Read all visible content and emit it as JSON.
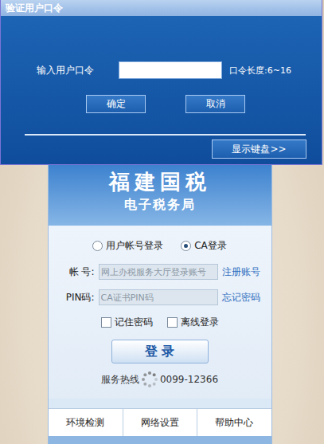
{
  "dialog": {
    "title": "验证用户口令",
    "password_label": "输入用户口令",
    "password_value": "",
    "length_hint": "口令长度:6~16",
    "buttons": [
      "确定",
      "取消"
    ],
    "keyboard_button": "显示键盘>>"
  },
  "login": {
    "brand": "福建国税",
    "subtitle": "电子税务局",
    "login_modes": [
      {
        "label": "用户帐号登录",
        "selected": false
      },
      {
        "label": "CA登录",
        "selected": true
      }
    ],
    "fields": [
      {
        "label": "帐 号:",
        "placeholder": "网上办税服务大厅登录账号",
        "link": "注册账号"
      },
      {
        "label": "PIN码:",
        "placeholder": "CA证书PIN码",
        "link": "忘记密码"
      }
    ],
    "options": [
      {
        "label": "记住密码",
        "checked": false
      },
      {
        "label": "离线登录",
        "checked": false
      }
    ],
    "submit": "登 录",
    "hotline_label": "服务热线",
    "hotline_number": "0099-12366",
    "loading": true,
    "footer": [
      "环境检测",
      "网络设置",
      "帮助中心"
    ]
  }
}
